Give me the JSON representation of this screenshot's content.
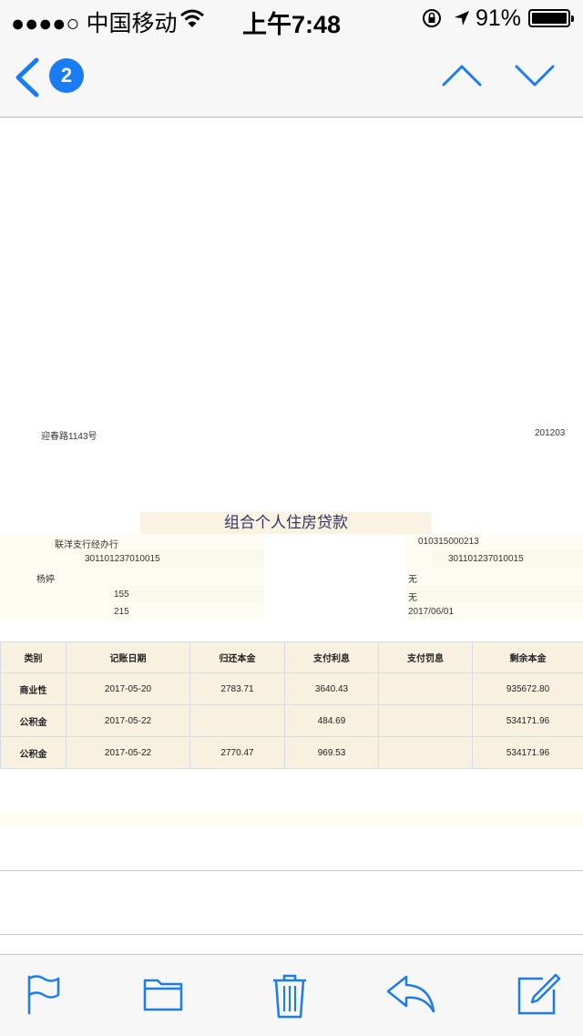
{
  "status_bar": {
    "carrier": "●●●●○ 中国移动",
    "time": "上午7:48",
    "battery": "91%"
  },
  "nav": {
    "unread_count": "2"
  },
  "doc": {
    "address": "迎春路1143号",
    "period": "201203",
    "title": "组合个人住房贷款",
    "fields": {
      "branch": "联洋支行经办行",
      "code_left": "301101237010015",
      "name": "杨婷",
      "term_a": "155",
      "term_b": "215",
      "code_right_top": "010315000213",
      "code_right": "301101237010015",
      "none_1": "无",
      "none_2": "无",
      "date": "2017/06/01"
    },
    "table": {
      "headers": [
        "类别",
        "记账日期",
        "归还本金",
        "支付利息",
        "支付罚息",
        "剩余本金"
      ],
      "rows": [
        [
          "商业性",
          "2017-05-20",
          "2783.71",
          "3640.43",
          "",
          "935672.80"
        ],
        [
          "公积金",
          "2017-05-22",
          "",
          "484.69",
          "",
          "534171.96"
        ],
        [
          "公积金",
          "2017-05-22",
          "2770.47",
          "969.53",
          "",
          "534171.96"
        ]
      ]
    }
  },
  "colors": {
    "accent": "#1a7cf5",
    "table_bg": "#f8f1e0",
    "title_text": "#333366"
  },
  "icons": {
    "back": "chevron-left-icon",
    "prev": "chevron-up-icon",
    "next": "chevron-down-icon",
    "flag": "flag-icon",
    "folder": "folder-icon",
    "trash": "trash-icon",
    "reply": "reply-icon",
    "compose": "compose-icon"
  }
}
